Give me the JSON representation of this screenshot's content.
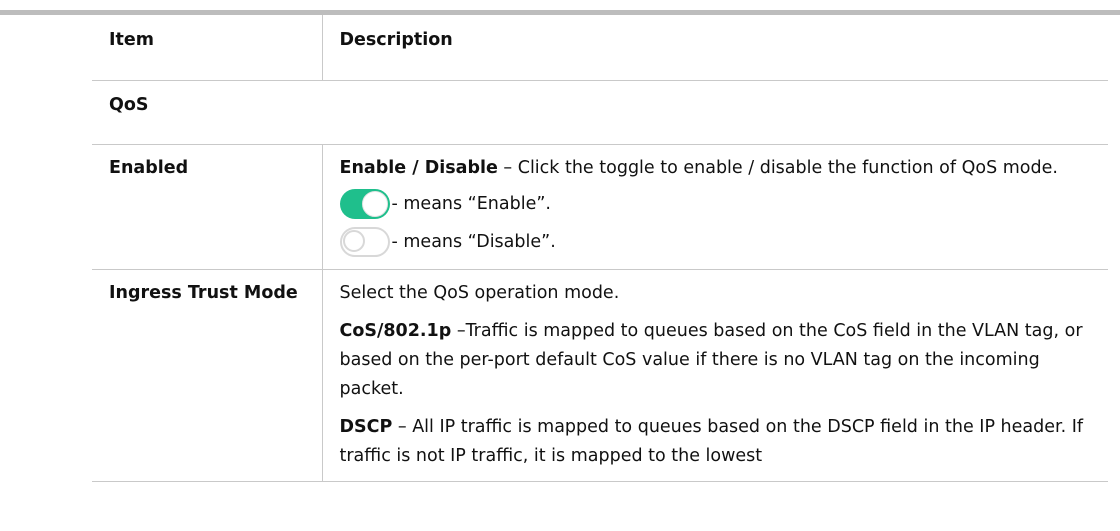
{
  "table": {
    "header": {
      "item": "Item",
      "description": "Description"
    },
    "section_title": "QoS",
    "rows": [
      {
        "item": "Enabled",
        "desc_bold": "Enable / Disable",
        "desc_text": " – Click the toggle to enable / disable the function of QoS mode.",
        "toggle_on_text": "- means “Enable”.",
        "toggle_off_text": "- means “Disable”."
      },
      {
        "item": "Ingress Trust Mode",
        "intro": "Select the QoS operation mode.",
        "cos_bold": "CoS/802.1p",
        "cos_text": " –Traffic is mapped to queues based on the CoS field in the VLAN tag, or based on the per-port default CoS value if there is no VLAN tag on the incoming packet.",
        "dscp_bold": "DSCP",
        "dscp_text": " – All IP traffic is mapped to queues based on the DSCP field in the IP header. If traffic is not IP traffic, it is mapped to the lowest"
      }
    ]
  },
  "colors": {
    "toggle_on": "#1fbf8c",
    "toggle_off_border": "#d8d8d8",
    "rule": "#c9c9c9",
    "top_bar": "#bdbdbd"
  }
}
